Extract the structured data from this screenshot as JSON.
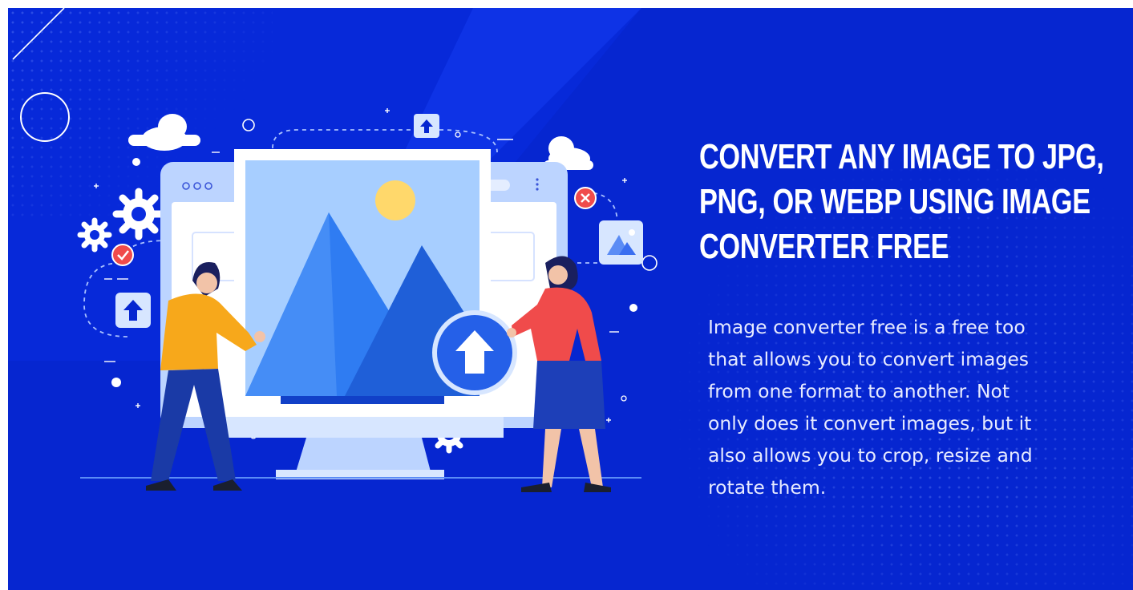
{
  "hero": {
    "title": "CONVERT ANY IMAGE TO JPG, PNG, OR WEBP USING IMAGE CONVERTER FREE",
    "title_lines": [
      "CONVERT ANY IMAGE TO JPG,",
      "PNG, OR WEBP USING IMAGE",
      "CONVERTER FREE"
    ],
    "description_lines": [
      "Image converter free is a free too",
      "that allows you to convert images",
      "from one format to another. Not",
      "only does it convert images, but it",
      "also allows you to crop, resize and",
      "rotate them."
    ]
  },
  "colors": {
    "background": "#0626d0",
    "accent_yellow": "#f7a81b",
    "accent_red": "#f04b4b",
    "monitor_light": "#d7e6ff"
  },
  "icons": [
    "cloud-icon",
    "gear-icon",
    "checkmark-icon",
    "close-icon",
    "upload-icon",
    "image-icon",
    "window-dots-icon"
  ]
}
